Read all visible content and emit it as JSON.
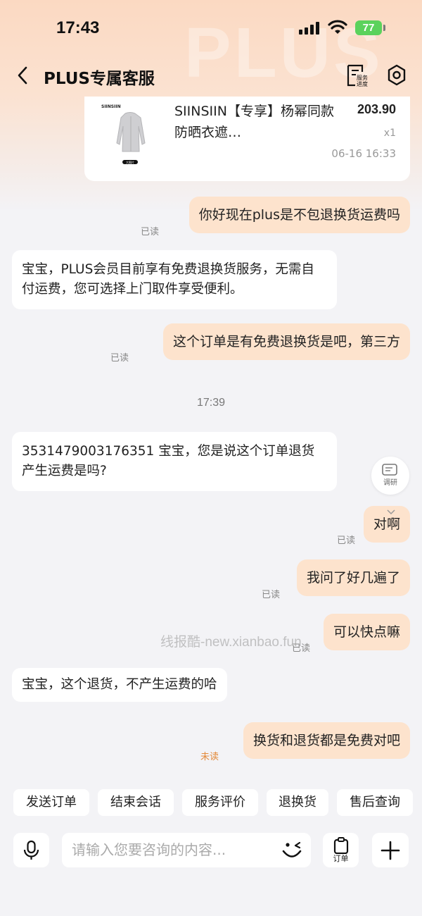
{
  "status_bar": {
    "time": "17:43",
    "battery": "77"
  },
  "header": {
    "title": "PLUS专属客服",
    "progress_label_1": "服务",
    "progress_label_2": "进度",
    "watermark": "PLUS"
  },
  "order": {
    "brand": "SIINSIIN",
    "image_tag": "大图片",
    "title": "SIINSIIN【专享】杨幂同款防晒衣遮…",
    "price": "203.90",
    "quantity": "x1",
    "time": "06-16 16:33"
  },
  "messages": {
    "m1": {
      "text": "你好现在plus是不包退换货运费吗",
      "status": "已读"
    },
    "m2": {
      "text": "宝宝，PLUS会员目前享有免费退换货服务，无需自付运费，您可选择上门取件享受便利。"
    },
    "m3": {
      "text": "这个订单是有免费退换货是吧，第三方",
      "status": "已读"
    },
    "time_divider": "17:39",
    "m4": {
      "text": "3531479003176351  宝宝，您是说这个订单退货产生运费是吗?"
    },
    "m5": {
      "text": "对啊",
      "status": "已读"
    },
    "m6": {
      "text": "我问了好几遍了",
      "status": "已读"
    },
    "m7": {
      "text": "可以快点嘛",
      "status": "已读"
    },
    "m8": {
      "text": "宝宝，这个退货，不产生运费的哈"
    },
    "m9": {
      "text": "换货和退货都是免费对吧",
      "status": "未读"
    }
  },
  "survey_label": "调研",
  "watermark_text": "线报酷-new.xianbao.fun",
  "quick_replies": [
    "发送订单",
    "结束会话",
    "服务评价",
    "退换货",
    "售后查询"
  ],
  "input": {
    "placeholder": "请输入您要咨询的内容...",
    "order_label": "订单"
  },
  "colors": {
    "outgoing_bubble": "#fde3cd",
    "incoming_bubble": "#ffffff",
    "unread": "#e38a3a",
    "battery": "#5bd25c"
  }
}
